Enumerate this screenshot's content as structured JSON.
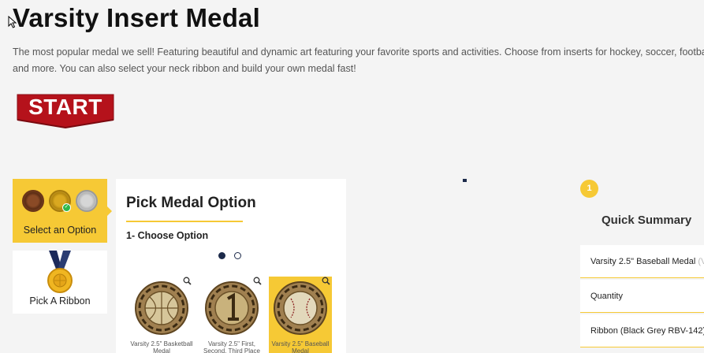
{
  "page": {
    "title": "Varsity Insert Medal",
    "description": "The most popular medal we sell! Featuring beautiful and dynamic art featuring your favorite sports and activities. Choose from inserts for hockey, soccer, football and more.  You can also select your neck ribbon and build your own medal fast!",
    "start_label": "START"
  },
  "steps": [
    {
      "label": "Select an Option",
      "active": true
    },
    {
      "label": "Pick A Ribbon",
      "active": false
    }
  ],
  "pick_panel": {
    "title": "Pick Medal Option",
    "subtitle": "1- Choose Option",
    "products": [
      {
        "name": "Varsity 2.5\" Basketball Medal",
        "selected": false
      },
      {
        "name": "Varsity 2.5\" First, Second, Third Place Medal",
        "selected": false
      },
      {
        "name": "Varsity 2.5\" Baseball Medal",
        "selected": true
      }
    ]
  },
  "summary": {
    "badge": "1",
    "title": "Quick Summary",
    "rows": [
      {
        "label": "Varsity 2.5\" Baseball Medal",
        "hint": "(V"
      },
      {
        "label": "Quantity"
      },
      {
        "label": "Ribbon (Black Grey RBV-142)"
      }
    ]
  },
  "colors": {
    "accent": "#f6c935",
    "start_button": "#b5121b",
    "dot_active": "#1c2a4a"
  }
}
